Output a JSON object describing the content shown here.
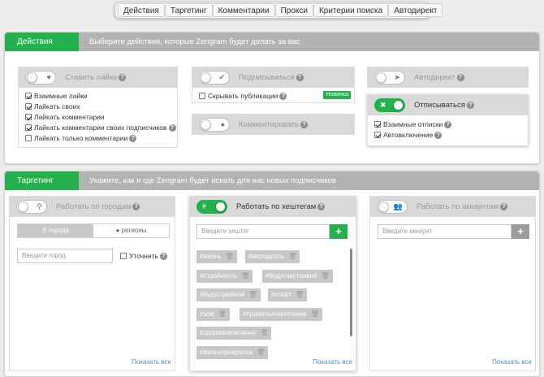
{
  "topnav": [
    "Действия",
    "Таргетинг",
    "Комментарии",
    "Прокси",
    "Критерии поиска",
    "Автодирект"
  ],
  "actions": {
    "tag": "Действия",
    "description": "Выберите действия, которые Zengram будет делать за вас",
    "likes": {
      "title": "Ставить лайки",
      "items": [
        {
          "label": "Взаимные лайки",
          "checked": true
        },
        {
          "label": "Лайкать своих",
          "checked": true
        },
        {
          "label": "Лайкать комментарии",
          "checked": true
        },
        {
          "label": "Лайкать комментарии своих подписчиков",
          "checked": true
        },
        {
          "label": "Лайкать только комментарии",
          "checked": false
        }
      ]
    },
    "follow": {
      "title": "Подписываться",
      "hide_label": "Скрывать публикации",
      "badge": "Новинка"
    },
    "comment": {
      "title": "Комментировать"
    },
    "autodirect": {
      "title": "Автодирект"
    },
    "unfollow": {
      "title": "Отписываться",
      "items": [
        {
          "label": "Взаимные отписки",
          "checked": true
        },
        {
          "label": "Автовключение",
          "checked": true
        }
      ]
    }
  },
  "targeting": {
    "tag": "Таргетинг",
    "description": "Укажите, как и где Zengram будет искать для вас новых подписчиков",
    "cities": {
      "title": "Работать по городам",
      "seg_cities": "города",
      "seg_regions": "регионы",
      "city_placeholder": "Введите город",
      "refine": "Уточнить",
      "show_all": "Показать все"
    },
    "hashtags": {
      "title": "Работать по хештегам",
      "placeholder": "Введите хештег",
      "tags": [
        "#жизнь",
        "#молодость",
        "#стройность",
        "#будусчастливой",
        "#будустройной",
        "#спорт",
        "#зож",
        "#правильноепитание",
        "#здоровоепитание",
        "#жизньпрекрасна"
      ],
      "show_all": "Показать все"
    },
    "accounts": {
      "title": "Работать по аккаунтам",
      "placeholder": "Введите аккаунт",
      "show_all": "Показать все"
    }
  },
  "colors": {
    "accent": "#22b14c",
    "header": "#b3b3b3",
    "link": "#4a90d9"
  }
}
